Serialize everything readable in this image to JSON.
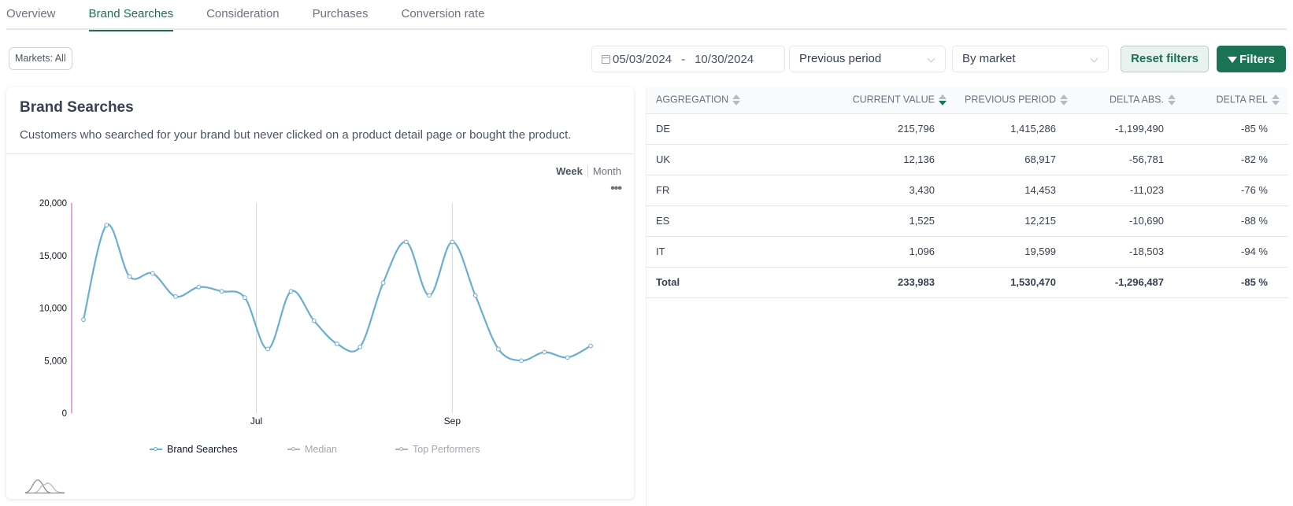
{
  "tabs": [
    {
      "label": "Overview",
      "active": false
    },
    {
      "label": "Brand Searches",
      "active": true
    },
    {
      "label": "Consideration",
      "active": false
    },
    {
      "label": "Purchases",
      "active": false
    },
    {
      "label": "Conversion rate",
      "active": false
    }
  ],
  "filters": {
    "markets_chip": "Markets: All",
    "date_from": "05/03/2024",
    "date_separator": "-",
    "date_to": "10/30/2024",
    "comparison_select": "Previous period",
    "grouping_select": "By market",
    "reset_label": "Reset filters",
    "filters_label": "Filters"
  },
  "card": {
    "title": "Brand Searches",
    "description": "Customers who searched for your brand but never clicked on a product detail page or bought the product.",
    "granularity": {
      "week": "Week",
      "month": "Month",
      "selected": "Week"
    },
    "more_icon": "•••"
  },
  "legend": [
    {
      "label": "Brand Searches",
      "color": "#6aaed0",
      "active": true
    },
    {
      "label": "Median",
      "color": "#b0b4ba",
      "active": false
    },
    {
      "label": "Top Performers",
      "color": "#b0b4ba",
      "active": false
    }
  ],
  "colors": {
    "accent": "#1a7352",
    "series": "#6aaed0",
    "axis_highlight": "#c04fc0"
  },
  "chart_data": {
    "type": "line",
    "title": "Brand Searches",
    "xlabel": "",
    "ylabel": "",
    "ylim": [
      0,
      20000
    ],
    "yticks": [
      0,
      5000,
      10000,
      15000,
      20000
    ],
    "ytick_labels": [
      "0",
      "5,000",
      "10,000",
      "15,000",
      "20,000"
    ],
    "x_period": "weekly",
    "x_month_markers": [
      {
        "label": "Jul",
        "index": 7.5
      },
      {
        "label": "Sep",
        "index": 16
      }
    ],
    "grid": false,
    "legend_position": "bottom",
    "series": [
      {
        "name": "Brand Searches",
        "values": [
          8900,
          17900,
          13000,
          13300,
          11100,
          12000,
          11600,
          11000,
          6100,
          11600,
          8800,
          6600,
          6300,
          12400,
          16300,
          11200,
          16300,
          11200,
          6100,
          5000,
          5800,
          5300,
          6400
        ]
      }
    ]
  },
  "table": {
    "columns": [
      {
        "label": "AGGREGATION",
        "sorted": false
      },
      {
        "label": "CURRENT VALUE",
        "sorted": true
      },
      {
        "label": "PREVIOUS PERIOD",
        "sorted": false
      },
      {
        "label": "DELTA ABS.",
        "sorted": false
      },
      {
        "label": "DELTA REL",
        "sorted": false
      }
    ],
    "rows": [
      [
        "DE",
        "215,796",
        "1,415,286",
        "-1,199,490",
        "-85 %"
      ],
      [
        "UK",
        "12,136",
        "68,917",
        "-56,781",
        "-82 %"
      ],
      [
        "FR",
        "3,430",
        "14,453",
        "-11,023",
        "-76 %"
      ],
      [
        "ES",
        "1,525",
        "12,215",
        "-10,690",
        "-88 %"
      ],
      [
        "IT",
        "1,096",
        "19,599",
        "-18,503",
        "-94 %"
      ]
    ],
    "total": [
      "Total",
      "233,983",
      "1,530,470",
      "-1,296,487",
      "-85 %"
    ]
  }
}
